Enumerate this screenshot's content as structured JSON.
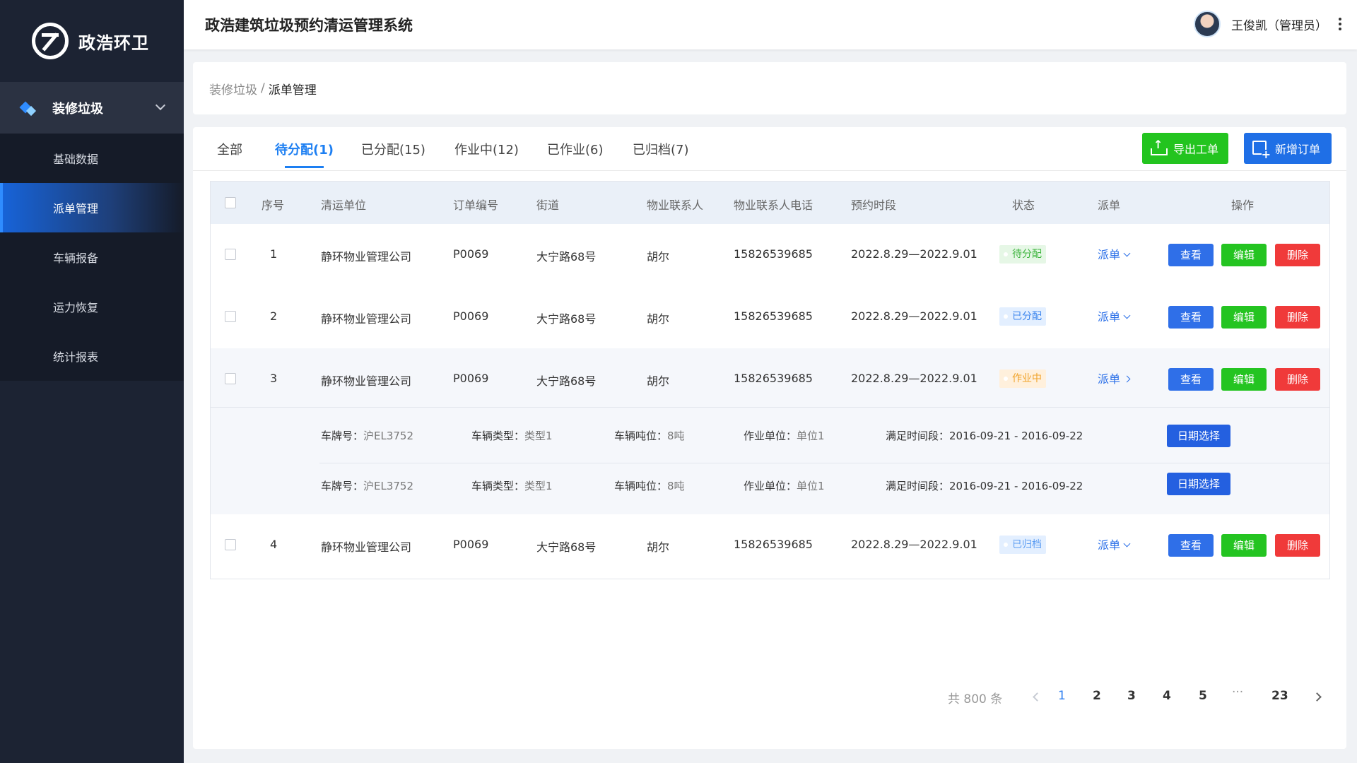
{
  "brand": {
    "name": "政浩环卫"
  },
  "header": {
    "title": "政浩建筑垃圾预约清运管理系统",
    "user": "王俊凯（管理员）"
  },
  "sidebar": {
    "group": "装修垃圾",
    "items": [
      {
        "label": "基础数据"
      },
      {
        "label": "派单管理"
      },
      {
        "label": "车辆报备"
      },
      {
        "label": "运力恢复"
      },
      {
        "label": "统计报表"
      }
    ]
  },
  "breadcrumb": {
    "parent": "装修垃圾",
    "sep": "/",
    "current": "派单管理"
  },
  "tabs": [
    {
      "label": "全部"
    },
    {
      "label": "待分配(1)"
    },
    {
      "label": "已分配(15)"
    },
    {
      "label": "作业中(12)"
    },
    {
      "label": "已作业(6)"
    },
    {
      "label": "已归档(7)"
    }
  ],
  "actions": {
    "export": "导出工单",
    "new": "新增订单"
  },
  "table": {
    "headers": [
      "序号",
      "清运单位",
      "订单编号",
      "街道",
      "物业联系人",
      "物业联系人电话",
      "预约时段",
      "状态",
      "派单",
      "操作"
    ],
    "rows": [
      {
        "no": "1",
        "unit": "静环物业管理公司",
        "order": "P0069",
        "street": "大宁路68号",
        "contact": "胡尔",
        "phone": "15826539685",
        "period": "2022.8.29—2022.9.01",
        "status": "待分配",
        "dispatch": "派单"
      },
      {
        "no": "2",
        "unit": "静环物业管理公司",
        "order": "P0069",
        "street": "大宁路68号",
        "contact": "胡尔",
        "phone": "15826539685",
        "period": "2022.8.29—2022.9.01",
        "status": "已分配",
        "dispatch": "派单"
      },
      {
        "no": "3",
        "unit": "静环物业管理公司",
        "order": "P0069",
        "street": "大宁路68号",
        "contact": "胡尔",
        "phone": "15826539685",
        "period": "2022.8.29—2022.9.01",
        "status": "作业中",
        "dispatch": "派单"
      },
      {
        "no": "4",
        "unit": "静环物业管理公司",
        "order": "P0069",
        "street": "大宁路68号",
        "contact": "胡尔",
        "phone": "15826539685",
        "period": "2022.8.29—2022.9.01",
        "status": "已归档",
        "dispatch": "派单"
      }
    ],
    "row_actions": {
      "view": "查看",
      "edit": "编辑",
      "delete": "删除"
    },
    "details": [
      {
        "plate_label": "车牌号：",
        "plate": "沪EL3752",
        "type_label": "车辆类型：",
        "type": "类型1",
        "ton_label": "车辆吨位：",
        "ton": "8吨",
        "unit_label": "作业单位：",
        "unit": "单位1",
        "time_label": "满足时间段：",
        "time": "2016-09-21 - 2016-09-22",
        "button": "日期选择"
      },
      {
        "plate_label": "车牌号：",
        "plate": "沪EL3752",
        "type_label": "车辆类型：",
        "type": "类型1",
        "ton_label": "车辆吨位：",
        "ton": "8吨",
        "unit_label": "作业单位：",
        "unit": "单位1",
        "time_label": "满足时间段：",
        "time": "2016-09-21 - 2016-09-22",
        "button": "日期选择"
      }
    ]
  },
  "pagination": {
    "total": "共 800 条",
    "pages": [
      "1",
      "2",
      "3",
      "4",
      "5"
    ],
    "ellipsis": "···",
    "last": "23",
    "current": "1"
  }
}
